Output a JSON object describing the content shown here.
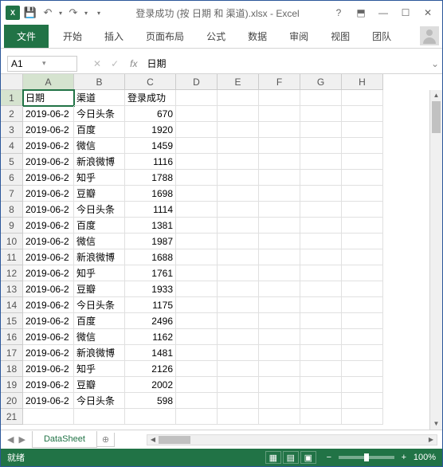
{
  "titlebar": {
    "app_title": "登录成功 (按 日期 和 渠道).xlsx - Excel"
  },
  "ribbon": {
    "file": "文件",
    "tabs": [
      "开始",
      "插入",
      "页面布局",
      "公式",
      "数据",
      "审阅",
      "视图",
      "团队"
    ]
  },
  "formula": {
    "namebox": "A1",
    "fx": "fx",
    "value": "日期"
  },
  "grid": {
    "cols": [
      "A",
      "B",
      "C",
      "D",
      "E",
      "F",
      "G",
      "H"
    ],
    "headers": [
      "日期",
      "渠道",
      "登录成功"
    ],
    "rows": [
      [
        "2019-06-2",
        "今日头条",
        "670"
      ],
      [
        "2019-06-2",
        "百度",
        "1920"
      ],
      [
        "2019-06-2",
        "微信",
        "1459"
      ],
      [
        "2019-06-2",
        "新浪微博",
        "1116"
      ],
      [
        "2019-06-2",
        "知乎",
        "1788"
      ],
      [
        "2019-06-2",
        "豆瓣",
        "1698"
      ],
      [
        "2019-06-2",
        "今日头条",
        "1114"
      ],
      [
        "2019-06-2",
        "百度",
        "1381"
      ],
      [
        "2019-06-2",
        "微信",
        "1987"
      ],
      [
        "2019-06-2",
        "新浪微博",
        "1688"
      ],
      [
        "2019-06-2",
        "知乎",
        "1761"
      ],
      [
        "2019-06-2",
        "豆瓣",
        "1933"
      ],
      [
        "2019-06-2",
        "今日头条",
        "1175"
      ],
      [
        "2019-06-2",
        "百度",
        "2496"
      ],
      [
        "2019-06-2",
        "微信",
        "1162"
      ],
      [
        "2019-06-2",
        "新浪微博",
        "1481"
      ],
      [
        "2019-06-2",
        "知乎",
        "2126"
      ],
      [
        "2019-06-2",
        "豆瓣",
        "2002"
      ],
      [
        "2019-06-2",
        "今日头条",
        "598"
      ]
    ]
  },
  "sheet": {
    "name": "DataSheet"
  },
  "status": {
    "ready": "就绪",
    "zoom": "100%"
  }
}
